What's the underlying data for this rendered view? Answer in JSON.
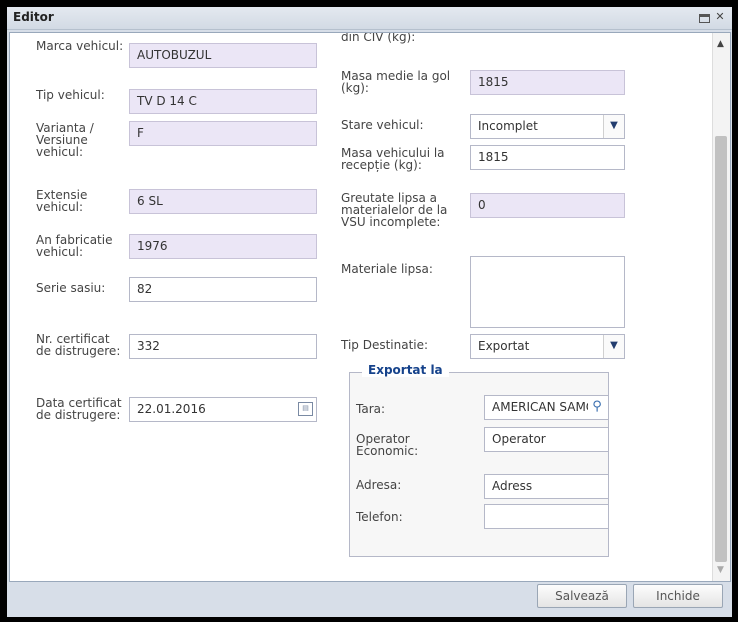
{
  "window": {
    "title": "Editor"
  },
  "left": {
    "marca": {
      "label": "Marca vehicul:",
      "value": "AUTOBUZUL"
    },
    "tip": {
      "label": "Tip vehicul:",
      "value": "TV D 14 C"
    },
    "varianta": {
      "label": "Varianta / Versiune vehicul:",
      "value": "F"
    },
    "extensie": {
      "label": "Extensie vehicul:",
      "value": "6 SL"
    },
    "an": {
      "label": "An fabricatie vehicul:",
      "value": "1976"
    },
    "serie": {
      "label": "Serie sasiu:",
      "value": "82"
    },
    "certificat": {
      "label": "Nr. certificat de distrugere:",
      "value": "332"
    },
    "data_cert": {
      "label": "Data certificat de distrugere:",
      "value": "22.01.2016"
    }
  },
  "right": {
    "cut_label": "din CIV (kg):",
    "masa_medie": {
      "label": "Masa medie la gol (kg):",
      "value": "1815"
    },
    "stare": {
      "label": "Stare vehicul:",
      "value": "Incomplet"
    },
    "masa_receptie": {
      "label": "Masa vehicului la recepție (kg):",
      "value": "1815"
    },
    "greutate": {
      "label": "Greutate lipsa a materialelor de la VSU incomplete:",
      "value": "0"
    },
    "materiale": {
      "label": "Materiale lipsa:",
      "value": ""
    },
    "destinatie": {
      "label": "Tip Destinatie:",
      "value": "Exportat"
    }
  },
  "export": {
    "legend": "Exportat la",
    "tara": {
      "label": "Tara:",
      "value": "AMERICAN SAMOA"
    },
    "operator": {
      "label": "Operator Economic:",
      "value": "Operator"
    },
    "adresa": {
      "label": "Adresa:",
      "value": "Adress"
    },
    "telefon": {
      "label": "Telefon:",
      "value": ""
    }
  },
  "footer": {
    "save": "Salvează",
    "close": "Inchide"
  }
}
